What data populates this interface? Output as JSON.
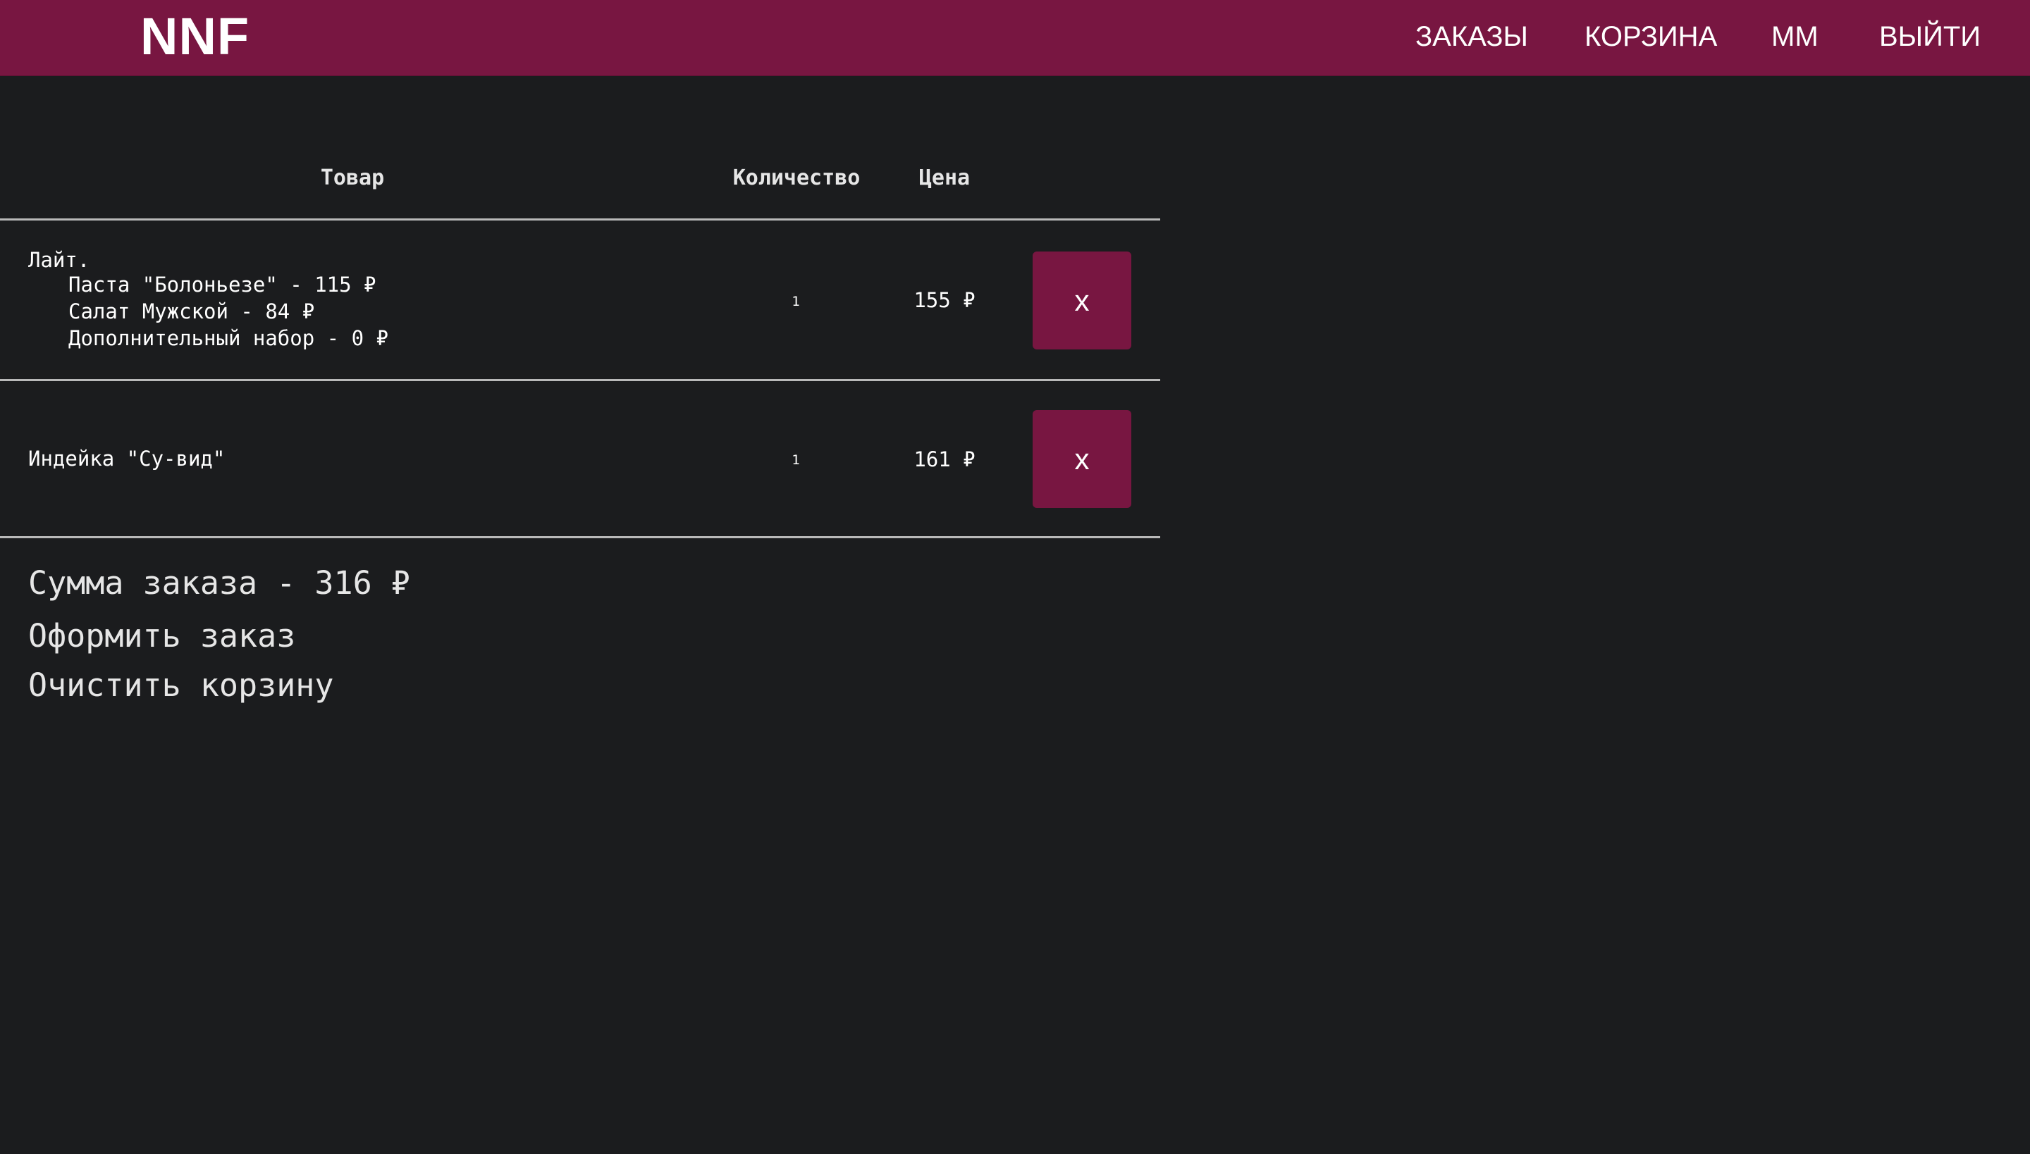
{
  "header": {
    "logo": "NNF",
    "nav": {
      "orders": "ЗАКАЗЫ",
      "cart": "КОРЗИНА",
      "user": "ММ",
      "logout": "ВЫЙТИ"
    }
  },
  "table": {
    "columns": {
      "product": "Товар",
      "quantity": "Количество",
      "price": "Цена"
    },
    "rows": [
      {
        "title": "Лайт.",
        "components": [
          "Паста \"Болоньезе\" - 115 ₽",
          "Салат Мужской - 84 ₽",
          "Дополнительный набор - 0 ₽"
        ],
        "quantity": "1",
        "price": "155 ₽",
        "remove_label": "x"
      },
      {
        "title": "Индейка \"Су-вид\"",
        "quantity": "1",
        "price": "161 ₽",
        "remove_label": "x"
      }
    ]
  },
  "summary": {
    "total": "Сумма заказа - 316 ₽",
    "checkout": "Оформить заказ",
    "clear": "Очистить корзину"
  },
  "colors": {
    "accent": "#781641",
    "background": "#1b1c1e",
    "divider": "#b9b9b9"
  }
}
